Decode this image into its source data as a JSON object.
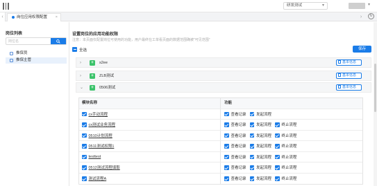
{
  "topbar": {
    "org_select": "研发测试",
    "caret": "▾"
  },
  "tabs": {
    "prev": "‹",
    "next": "›",
    "active_tab": "岗位应用权限配置",
    "close": "×",
    "refresh": "↻"
  },
  "left": {
    "title": "岗位列表",
    "search_placeholder": "岗位名",
    "items": [
      {
        "label": "推保员"
      },
      {
        "label": "推保主管"
      }
    ]
  },
  "main": {
    "title": "设置岗位的应用功能权限",
    "note": "注意：本页面仅配置岗位可使用的功能，用户最终在工单看页面的数据范围确被\"可见范围\"",
    "select_all": "全选",
    "save": "保存",
    "groups": [
      {
        "chevron": "›",
        "icon": "+",
        "name": "s2ee",
        "info": "基本信息"
      },
      {
        "chevron": "›",
        "icon": "+",
        "name": "ZLB测试",
        "info": "基本信息"
      },
      {
        "chevron": "⌄",
        "icon": "+",
        "name": "0506测试",
        "info": "基本信息"
      }
    ],
    "table": {
      "headers": [
        "模块名称",
        "功能"
      ],
      "rows": [
        {
          "module": "cx手动流程",
          "functions": [
            "查看记录",
            "发起流程"
          ]
        },
        {
          "module": "cx测试业务流程",
          "functions": [
            "查看记录",
            "发起流程",
            "终止流程"
          ]
        },
        {
          "module": "0510计划流程",
          "functions": [
            "查看记录",
            "发起流程",
            "终止流程"
          ]
        },
        {
          "module": "0511测试权限1",
          "functions": [
            "查看记录",
            "发起流程",
            "终止流程"
          ]
        },
        {
          "module": "testtest",
          "functions": [
            "查看记录",
            "发起流程",
            "终止流程"
          ]
        },
        {
          "module": "0512测试流程填取",
          "functions": [
            "查看记录",
            "发起流程",
            "终止流程"
          ]
        },
        {
          "module": "测试流程A",
          "functions": [
            "查看记录",
            "发起流程",
            "终止流程"
          ]
        }
      ]
    }
  },
  "colors": {
    "primary": "#1a7ce8",
    "group_icon": "#3cc36b"
  }
}
